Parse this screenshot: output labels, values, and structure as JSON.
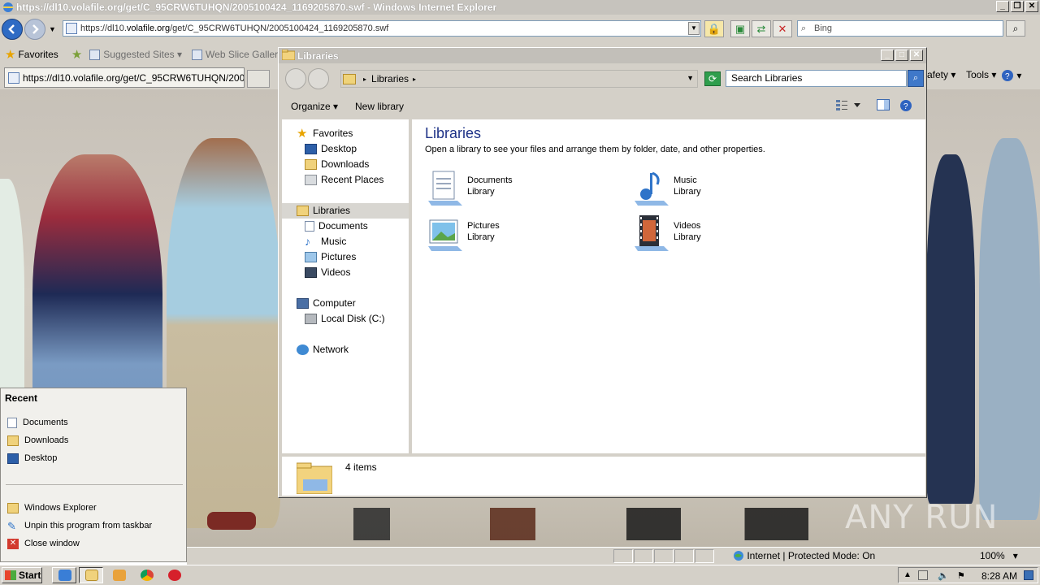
{
  "ie": {
    "title": "https://dl10.volafile.org/get/C_95CRW6TUHQN/2005100424_1169205870.swf - Windows Internet Explorer",
    "url_prefix": "https://dl10.",
    "url_domain": "volafile.org",
    "url_path": "/get/C_95CRW6TUHQN/2005100424_1169205870.swf",
    "search_placeholder": "Bing",
    "favorites_label": "Favorites",
    "suggested_sites": "Suggested Sites",
    "web_slice_gallery": "Web Slice Gallery",
    "tab_title": "https://dl10.volafile.org/get/C_95CRW6TUHQN/2005...",
    "safety_label": "afety",
    "tools_label": "Tools",
    "status_zone": "Internet | Protected Mode: On",
    "zoom": "100%"
  },
  "explorer": {
    "title": "Libraries",
    "breadcrumb": "Libraries",
    "search_placeholder": "Search Libraries",
    "toolbar": {
      "organize": "Organize",
      "new_library": "New library"
    },
    "nav": {
      "favorites": "Favorites",
      "desktop": "Desktop",
      "downloads": "Downloads",
      "recent_places": "Recent Places",
      "libraries": "Libraries",
      "documents": "Documents",
      "music": "Music",
      "pictures": "Pictures",
      "videos": "Videos",
      "computer": "Computer",
      "local_disk": "Local Disk (C:)",
      "network": "Network"
    },
    "heading": "Libraries",
    "subheading": "Open a library to see your files and arrange them by folder, date, and other properties.",
    "libraries": [
      {
        "name": "Documents",
        "type": "Library"
      },
      {
        "name": "Music",
        "type": "Library"
      },
      {
        "name": "Pictures",
        "type": "Library"
      },
      {
        "name": "Videos",
        "type": "Library"
      }
    ],
    "item_count": "4 items"
  },
  "jumplist": {
    "header": "Recent",
    "recent": [
      "Documents",
      "Downloads",
      "Desktop"
    ],
    "tasks": [
      "Windows Explorer",
      "Unpin this program from taskbar",
      "Close window"
    ]
  },
  "taskbar": {
    "start": "Start",
    "clock": "8:28 AM"
  },
  "watermark": "ANY RUN",
  "colors": {
    "selection": "#d8d6d1",
    "heading": "#1e3287",
    "chrome": "#d4d0c8"
  }
}
